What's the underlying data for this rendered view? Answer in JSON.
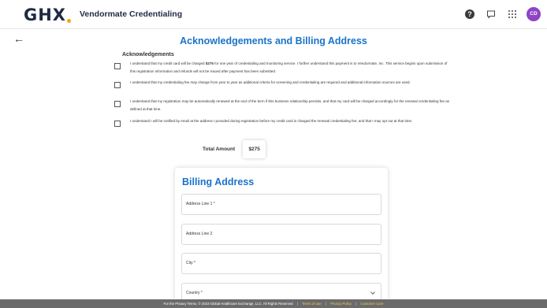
{
  "header": {
    "logo_text": "GHX",
    "app_title": "Vendormate Credentialing",
    "avatar_initials": "CD",
    "icons": [
      "help-icon",
      "chat-icon",
      "apps-grid-icon"
    ]
  },
  "page": {
    "back_icon": "←",
    "title": "Acknowledgements and Billing Address",
    "section_label": "Acknowledgements"
  },
  "acknowledgements": [
    {
      "checked": false,
      "text_before": "I understand that my credit card will be charged ",
      "amount": "$275",
      "text_after": " for one year of credentialing and monitoring service. I further understand this payment is to Vendormate, Inc. This service begins upon submission of this registration information and refunds will not be issued after payment has been submitted."
    },
    {
      "checked": false,
      "text": "I understand that my credentialing fee may change from year to year as additional criteria for screening and credentialing are required and additional information sources are used."
    },
    {
      "checked": false,
      "text": "I understand that my registration may be automatically renewed at the end of the term if this business relationship persists, and that my card will be charged accordingly for the renewal credentialing fee as defined at that time."
    },
    {
      "checked": false,
      "text": "I understand I will be notified by email at the address I provided during registration before my credit card is charged the renewal credentialing fee; and that I may opt out at that time."
    }
  ],
  "total": {
    "label": "Total Amount",
    "value": "$275"
  },
  "billing": {
    "title": "Billing Address",
    "fields": [
      {
        "label": "Address Line 1 *"
      },
      {
        "label": "Address Line 2"
      },
      {
        "label": "City *"
      },
      {
        "label": "Country *"
      }
    ]
  },
  "footer": {
    "text": "For the Privacy Terms, © 2023 Global Healthcare Exchange, LLC. All Rights Reserved",
    "sep": "|",
    "links": [
      "Terms of use",
      "Privacy Policy",
      "Customer Care"
    ]
  },
  "colors": {
    "accent": "#1a73c9",
    "avatar": "#8e44c4",
    "footer_bg": "#6b6b6b",
    "footer_link": "#f2c94c"
  }
}
